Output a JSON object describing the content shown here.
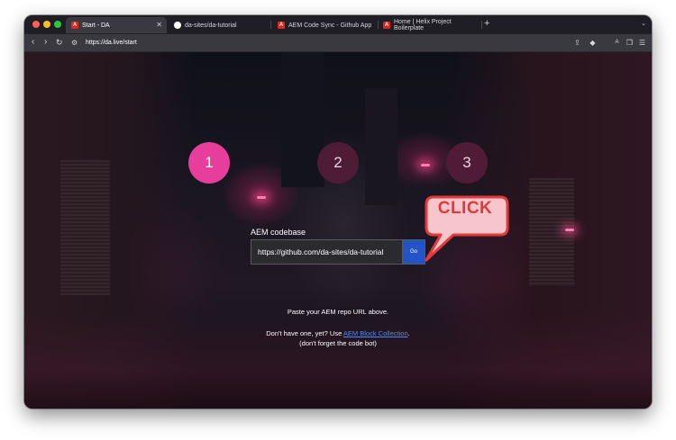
{
  "browser": {
    "tabs": [
      {
        "title": "Start - DA",
        "favicon": "adobe-icon",
        "active": true
      },
      {
        "title": "da-sites/da-tutorial",
        "favicon": "github-icon",
        "active": false
      },
      {
        "title": "AEM Code Sync - Github App",
        "favicon": "adobe-icon",
        "active": false
      },
      {
        "title": "Home | Helix Project Boilerplate",
        "favicon": "adobe-icon",
        "active": false
      }
    ],
    "url": "https://da.live/start"
  },
  "steps": [
    "1",
    "2",
    "3"
  ],
  "form": {
    "label": "AEM codebase",
    "input_value": "https://github.com/da-sites/da-tutorial",
    "go_label": "Go"
  },
  "callout": {
    "text": "CLICK",
    "color": "#e23a3a"
  },
  "help": {
    "paste_text": "Paste your AEM repo URL above.",
    "dont_have": "Don't have one, yet? Use",
    "link_text": "AEM Block Collection",
    "period": ".",
    "note": "(don't forget the code bot)"
  },
  "colors": {
    "active_step": "#e63e9a",
    "go_button": "#2253c7",
    "link": "#4a8bff"
  }
}
